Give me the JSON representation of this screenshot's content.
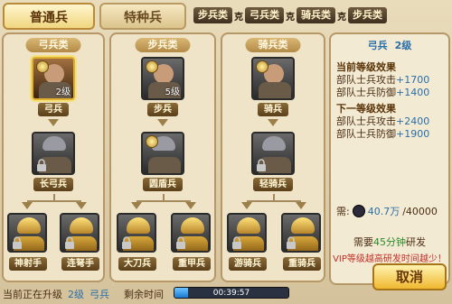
{
  "tabs": {
    "regular": "普通兵",
    "special": "特种兵"
  },
  "breadcrumb": [
    "步兵类",
    "弓兵类",
    "骑兵类",
    "步兵类"
  ],
  "crumb_sep": "克",
  "columns": [
    {
      "title": "弓兵类",
      "tier1": {
        "name": "弓兵",
        "level": "2级"
      },
      "tier2": {
        "name": "长弓兵"
      },
      "tier3": [
        {
          "name": "神射手"
        },
        {
          "name": "连弩手"
        }
      ]
    },
    {
      "title": "步兵类",
      "tier1": {
        "name": "步兵",
        "level": "5级"
      },
      "tier2": {
        "name": "圆盾兵"
      },
      "tier3": [
        {
          "name": "大刀兵"
        },
        {
          "name": "重甲兵"
        }
      ]
    },
    {
      "title": "骑兵类",
      "tier1": {
        "name": "骑兵"
      },
      "tier2": {
        "name": "轻骑兵"
      },
      "tier3": [
        {
          "name": "游骑兵"
        },
        {
          "name": "重骑兵"
        }
      ]
    }
  ],
  "detail": {
    "name": "弓兵",
    "level": "2级",
    "current_header": "当前等级效果",
    "current_atk_label": "部队士兵攻击",
    "current_atk_value": "+1700",
    "current_def_label": "部队士兵防御",
    "current_def_value": "+1400",
    "next_header": "下一等级效果",
    "next_atk_label": "部队士兵攻击",
    "next_atk_value": "+2400",
    "next_def_label": "部队士兵防御",
    "next_def_value": "+1900",
    "cost_label": "需:",
    "cost_current": "40.7万",
    "cost_required": "/40000",
    "need_prefix": "需要",
    "need_time": "45分钟",
    "need_suffix": "研发",
    "vip_note": "VIP等级越高研发时间越少！",
    "cancel": "取消"
  },
  "status": {
    "upgrading_label": "当前正在升级",
    "upgrading_level": "2级",
    "upgrading_unit": "弓兵",
    "remaining_label": "剩余时间",
    "timer": "00:39:57",
    "progress": 0.12
  },
  "colors": {
    "accent_blue": "#2a6ea8",
    "time_green": "#2a8a2a",
    "warn_red": "#c0302a"
  }
}
